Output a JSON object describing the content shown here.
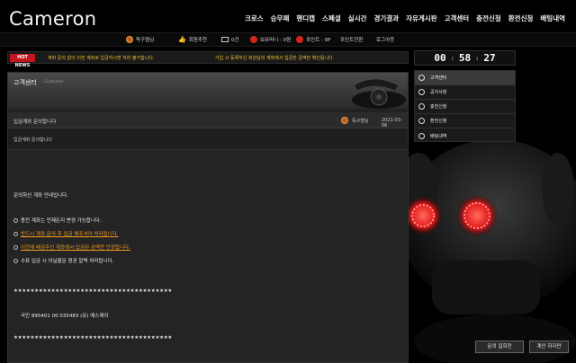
{
  "header": {
    "logo": "Cameron",
    "nav": [
      "크로스",
      "승무패",
      "핸디캡",
      "스페셜",
      "실시간",
      "경기결과",
      "자유게시판",
      "고객센터",
      "충전신청",
      "환전신청",
      "배팅내역"
    ]
  },
  "userbar": {
    "nickname": "독구형님",
    "recommend_label": "회원추천",
    "message_count": "0건",
    "holding_money": "보유머니 : 0원",
    "points": "포인트 : 0P",
    "point_convert": "포인트전환",
    "logout": "로그아웃"
  },
  "news": {
    "badge": "HOT NEWS",
    "text1": "계좌 문의 없이 이전 계좌로 입금하시면 처리 불가합니다.",
    "text2": "가입 시 등록하신 회원님의 계좌에서 입금한 금액만 확인됩니다."
  },
  "clock": {
    "h": "00",
    "m": "58",
    "s": "27"
  },
  "cs": {
    "title": "고객센터",
    "subtitle": "Customer"
  },
  "post": {
    "title": "입금계좌 문의합니다",
    "author": "독구형님",
    "date": "2021-03-06",
    "subject_repeat": "입금계좌 문의합니다",
    "lines": [
      "문의하신 계좌 안내입니다.",
      "충전 계좌는 언제든지 변경 가능합니다.",
      "반드시 계좌 문의 후 입금 해주셔야 처리됩니다.",
      "이전에 배금주신 계좌에서 입금된 금액만 인정됩니다.",
      "수표 입금 시 아닐불문 원권 알력 처리됩니다."
    ],
    "stars": "★★★★★★★★★★★★★★★★★★★★★★★★★★★★★★★★★★★★★★",
    "account": "국민  895401 00 035483  (유) 에스제이"
  },
  "sidebar": {
    "items": [
      "고객센터",
      "공지사항",
      "충전신청",
      "환전신청",
      "배팅내역"
    ]
  },
  "buttons": {
    "inquire": "문의 일회전",
    "confirm": "계인 하지만"
  }
}
